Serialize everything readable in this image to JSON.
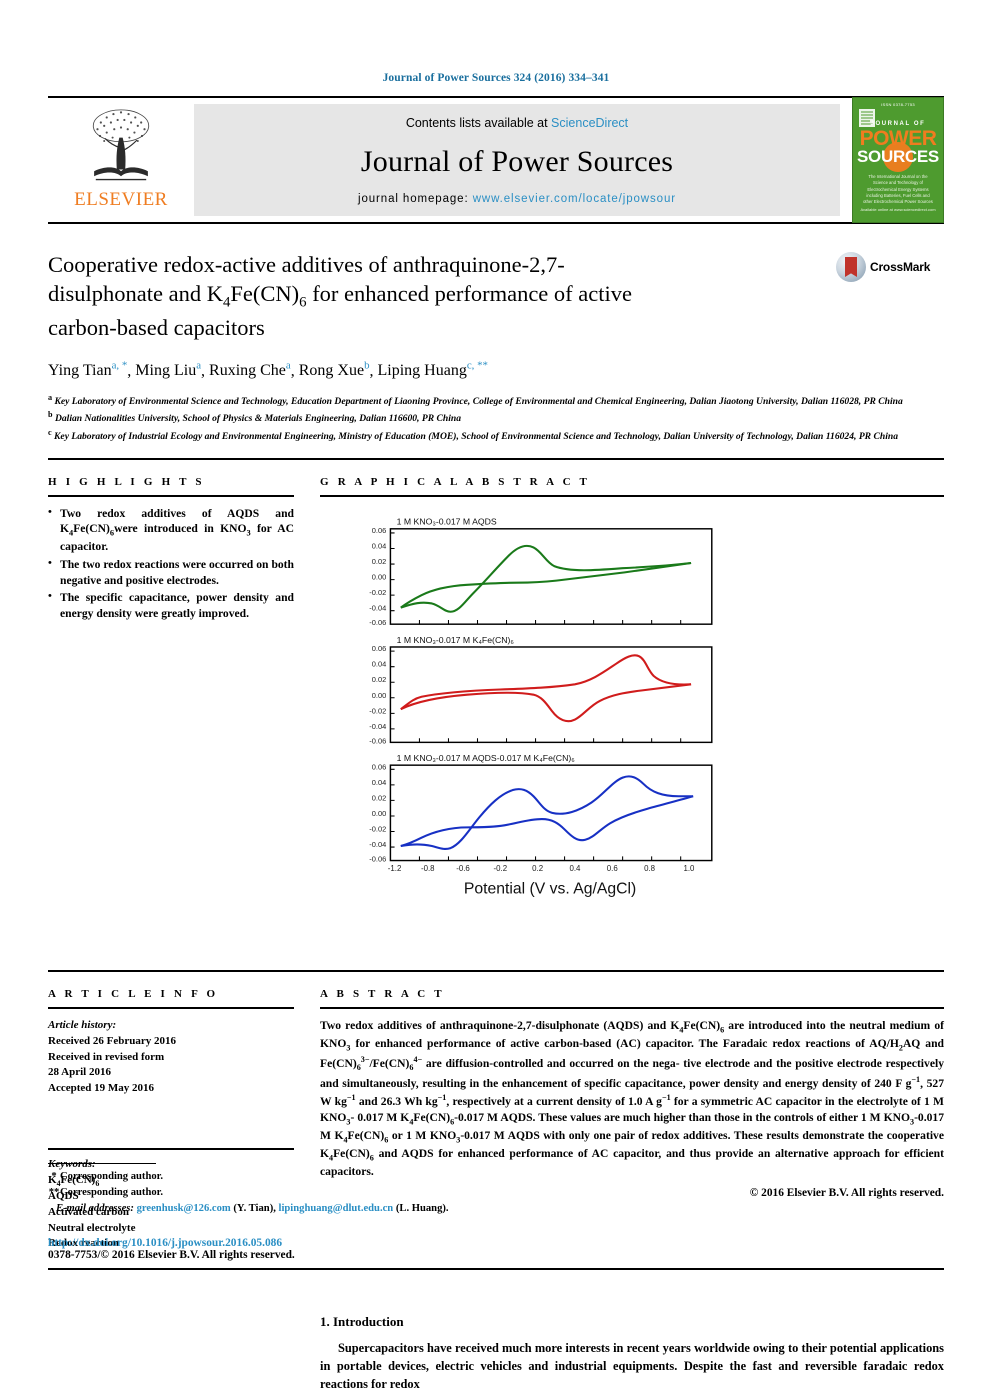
{
  "running_head": "Journal of Power Sources 324 (2016) 334–341",
  "masthead": {
    "contents_prefix": "Contents lists available at ",
    "sciencedirect": "ScienceDirect",
    "journal_title": "Journal of Power Sources",
    "homepage_prefix": "journal homepage: ",
    "homepage_url": "www.elsevier.com/locate/jpowsour",
    "publisher_wordmark": "ELSEVIER",
    "cover": {
      "issn_top": "ISSN 0378-7753",
      "journal_of": "JOURNAL OF",
      "power": "POWER",
      "sources": "SOURCES",
      "subtitle": "The International Journal on the Science and Technology of Electrochemical Energy Systems including Batteries, Fuel Cells and other Electrochemical Power Sources",
      "footer": "Available online at www.sciencedirect.com"
    }
  },
  "article": {
    "title_line1": "Cooperative redox-active additives of anthraquinone-2,7-",
    "title_line2_a": "disulphonate and K",
    "title_line2_sub1": "4",
    "title_line2_b": "Fe(CN)",
    "title_line2_sub2": "6",
    "title_line2_c": " for enhanced performance of active",
    "title_line3": "carbon-based capacitors",
    "crossmark_label": "CrossMark",
    "authors": [
      {
        "name": "Ying Tian",
        "sup": "a, *"
      },
      {
        "name": "Ming Liu",
        "sup": "a"
      },
      {
        "name": "Ruxing Che",
        "sup": "a"
      },
      {
        "name": "Rong Xue",
        "sup": "b"
      },
      {
        "name": "Liping Huang",
        "sup": "c, **"
      }
    ],
    "affiliations": [
      {
        "marker": "a",
        "text": "Key Laboratory of Environmental Science and Technology, Education Department of Liaoning Province, College of Environmental and Chemical Engineering, Dalian Jiaotong University, Dalian 116028, PR China"
      },
      {
        "marker": "b",
        "text": "Dalian Nationalities University, School of Physics & Materials Engineering, Dalian 116600, PR China"
      },
      {
        "marker": "c",
        "text": "Key Laboratory of Industrial Ecology and Environmental Engineering, Ministry of Education (MOE), School of Environmental Science and Technology, Dalian University of Technology, Dalian 116024, PR China"
      }
    ]
  },
  "highlights": {
    "heading": "H I G H L I G H T S",
    "items": [
      "Two redox additives of AQDS and K4Fe(CN)6were introduced in KNO3 for AC capacitor.",
      "The two redox reactions were occurred on both negative and positive electrodes.",
      "The specific capacitance, power density and energy density were greatly improved."
    ]
  },
  "graphical_abstract": {
    "heading": "G R A P H I C A L   A B S T R A C T"
  },
  "article_info": {
    "heading": "A R T I C L E   I N F O",
    "history_label": "Article history:",
    "history": [
      "Received 26 February 2016",
      "Received in revised form",
      "28 April 2016",
      "Accepted 19 May 2016"
    ],
    "keywords_label": "Keywords:",
    "keywords": [
      "K4Fe(CN)6",
      "AQDS",
      "Activated carbon",
      "Neutral electrolyte",
      "Redox reaction"
    ]
  },
  "abstract": {
    "heading": "A B S T R A C T",
    "text": "Two redox additives of anthraquinone-2,7-disulphonate (AQDS) and K4Fe(CN)6 are introduced into the neutral medium of KNO3 for enhanced performance of active carbon-based (AC) capacitor. The Faradaic redox reactions of AQ/H2AQ and Fe(CN)63-/Fe(CN)64- are diffusion-controlled and occurred on the negative electrode and the positive electrode respectively and simultaneously, resulting in the enhancement of specific capacitance, power density and energy density of 240 F g-1, 527 W kg-1 and 26.3 Wh kg-1, respectively at a current density of 1.0 A g-1 for a symmetric AC capacitor in the electrolyte of 1 M KNO3-0.017 M K4Fe(CN)6-0.017 M AQDS. These values are much higher than those in the controls of either 1 M KNO3-0.017 M K4Fe(CN)6 or 1 M KNO3-0.017 M AQDS with only one pair of redox additives. These results demonstrate the cooperative K4Fe(CN)6 and AQDS for enhanced performance of AC capacitor, and thus provide an alternative approach for efficient capacitors.",
    "copyright": "© 2016 Elsevier B.V. All rights reserved."
  },
  "introduction": {
    "heading": "1.  Introduction",
    "paragraph": "Supercapacitors have received much more interests in recent years worldwide owing to their potential applications in portable devices, electric vehicles and industrial equipments. Despite the fast and reversible faradaic redox reactions for redox"
  },
  "footnotes": {
    "corr1_marker": "*",
    "corr1": "Corresponding author.",
    "corr2_marker": "**",
    "corr2": "Corresponding author.",
    "email_label": "E-mail addresses:",
    "email1": "greenhusk@126.com",
    "email1_who": "(Y. Tian),",
    "email2": "lipinghuang@dlut.edu.cn",
    "email2_who": "(L. Huang).",
    "doi": "http://dx.doi.org/10.1016/j.jpowsour.2016.05.086",
    "issn": "0378-7753/© 2016 Elsevier B.V. All rights reserved."
  },
  "chart_data": [
    {
      "type": "line",
      "title": "1 M KNO3-0.017 M AQDS",
      "color": "#1a7a1a",
      "xlabel": "Potential (V vs. Ag/AgCl)",
      "ylabel": "",
      "xlim": [
        -1.2,
        1.0
      ],
      "ylim": [
        -0.06,
        0.06
      ],
      "xticks": [
        -1.2,
        -0.8,
        -0.6,
        -0.2,
        0.2,
        0.4,
        0.6,
        0.8,
        1.0
      ],
      "yticks": [
        0.06,
        0.04,
        0.02,
        0.0,
        -0.02,
        -0.04,
        -0.06
      ],
      "ytick_labels": [
        "0.06",
        "0.04",
        "0.02",
        "0.00",
        "-0.02",
        "-0.04",
        "-0.06"
      ],
      "grid": false
    },
    {
      "type": "line",
      "title": "1 M KNO3-0.017 M K4Fe(CN)6",
      "color": "#d01c1c",
      "xlabel": "Potential (V vs. Ag/AgCl)",
      "ylabel": "",
      "xlim": [
        -1.2,
        1.0
      ],
      "ylim": [
        -0.06,
        0.06
      ],
      "yticks": [
        0.06,
        0.04,
        0.02,
        0.0,
        -0.02,
        -0.04,
        -0.06
      ],
      "ytick_labels": [
        "0.06",
        "0.04",
        "0.02",
        "0.00",
        "-0.02",
        "-0.04",
        "-0.06"
      ],
      "grid": false
    },
    {
      "type": "line",
      "title": "1 M KNO3-0.017 M AQDS-0.017 M K4Fe(CN)6",
      "color": "#1730c4",
      "xlabel": "Potential (V vs. Ag/AgCl)",
      "ylabel": "",
      "xlim": [
        -1.2,
        1.0
      ],
      "ylim": [
        -0.06,
        0.06
      ],
      "xtick_labels": [
        "-1.2",
        "-0.8",
        "-0.6",
        "-0.2",
        "0.2",
        "0.4",
        "0.6",
        "0.8",
        "1.0"
      ],
      "yticks": [
        0.06,
        0.04,
        0.02,
        0.0,
        -0.02,
        -0.04,
        -0.06
      ],
      "ytick_labels": [
        "0.06",
        "0.04",
        "0.02",
        "0.00",
        "-0.02",
        "-0.04",
        "-0.06"
      ],
      "grid": false
    }
  ],
  "colors": {
    "link": "#2b8fc4",
    "elsevier_orange": "#ef7d22",
    "cover_green": "#4e9b2f",
    "cv_green": "#1a7a1a",
    "cv_red": "#d01c1c",
    "cv_blue": "#1730c4"
  }
}
